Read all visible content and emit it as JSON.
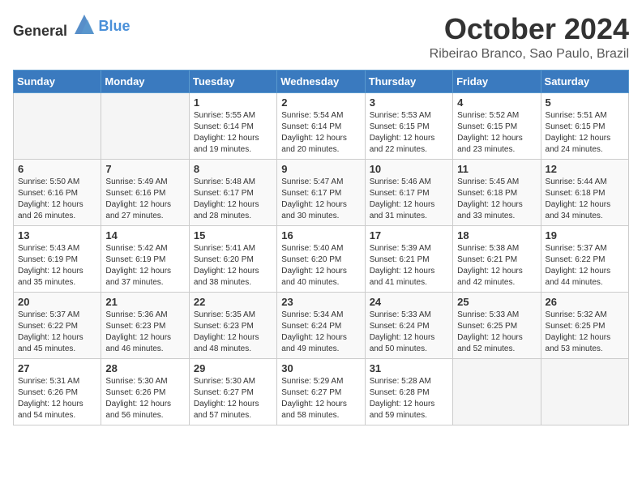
{
  "logo": {
    "general": "General",
    "blue": "Blue"
  },
  "title": "October 2024",
  "location": "Ribeirao Branco, Sao Paulo, Brazil",
  "days": [
    "Sunday",
    "Monday",
    "Tuesday",
    "Wednesday",
    "Thursday",
    "Friday",
    "Saturday"
  ],
  "weeks": [
    [
      {
        "day": "",
        "empty": true
      },
      {
        "day": "",
        "empty": true
      },
      {
        "day": "1",
        "sunrise": "Sunrise: 5:55 AM",
        "sunset": "Sunset: 6:14 PM",
        "daylight": "Daylight: 12 hours and 19 minutes."
      },
      {
        "day": "2",
        "sunrise": "Sunrise: 5:54 AM",
        "sunset": "Sunset: 6:14 PM",
        "daylight": "Daylight: 12 hours and 20 minutes."
      },
      {
        "day": "3",
        "sunrise": "Sunrise: 5:53 AM",
        "sunset": "Sunset: 6:15 PM",
        "daylight": "Daylight: 12 hours and 22 minutes."
      },
      {
        "day": "4",
        "sunrise": "Sunrise: 5:52 AM",
        "sunset": "Sunset: 6:15 PM",
        "daylight": "Daylight: 12 hours and 23 minutes."
      },
      {
        "day": "5",
        "sunrise": "Sunrise: 5:51 AM",
        "sunset": "Sunset: 6:15 PM",
        "daylight": "Daylight: 12 hours and 24 minutes."
      }
    ],
    [
      {
        "day": "6",
        "sunrise": "Sunrise: 5:50 AM",
        "sunset": "Sunset: 6:16 PM",
        "daylight": "Daylight: 12 hours and 26 minutes."
      },
      {
        "day": "7",
        "sunrise": "Sunrise: 5:49 AM",
        "sunset": "Sunset: 6:16 PM",
        "daylight": "Daylight: 12 hours and 27 minutes."
      },
      {
        "day": "8",
        "sunrise": "Sunrise: 5:48 AM",
        "sunset": "Sunset: 6:17 PM",
        "daylight": "Daylight: 12 hours and 28 minutes."
      },
      {
        "day": "9",
        "sunrise": "Sunrise: 5:47 AM",
        "sunset": "Sunset: 6:17 PM",
        "daylight": "Daylight: 12 hours and 30 minutes."
      },
      {
        "day": "10",
        "sunrise": "Sunrise: 5:46 AM",
        "sunset": "Sunset: 6:17 PM",
        "daylight": "Daylight: 12 hours and 31 minutes."
      },
      {
        "day": "11",
        "sunrise": "Sunrise: 5:45 AM",
        "sunset": "Sunset: 6:18 PM",
        "daylight": "Daylight: 12 hours and 33 minutes."
      },
      {
        "day": "12",
        "sunrise": "Sunrise: 5:44 AM",
        "sunset": "Sunset: 6:18 PM",
        "daylight": "Daylight: 12 hours and 34 minutes."
      }
    ],
    [
      {
        "day": "13",
        "sunrise": "Sunrise: 5:43 AM",
        "sunset": "Sunset: 6:19 PM",
        "daylight": "Daylight: 12 hours and 35 minutes."
      },
      {
        "day": "14",
        "sunrise": "Sunrise: 5:42 AM",
        "sunset": "Sunset: 6:19 PM",
        "daylight": "Daylight: 12 hours and 37 minutes."
      },
      {
        "day": "15",
        "sunrise": "Sunrise: 5:41 AM",
        "sunset": "Sunset: 6:20 PM",
        "daylight": "Daylight: 12 hours and 38 minutes."
      },
      {
        "day": "16",
        "sunrise": "Sunrise: 5:40 AM",
        "sunset": "Sunset: 6:20 PM",
        "daylight": "Daylight: 12 hours and 40 minutes."
      },
      {
        "day": "17",
        "sunrise": "Sunrise: 5:39 AM",
        "sunset": "Sunset: 6:21 PM",
        "daylight": "Daylight: 12 hours and 41 minutes."
      },
      {
        "day": "18",
        "sunrise": "Sunrise: 5:38 AM",
        "sunset": "Sunset: 6:21 PM",
        "daylight": "Daylight: 12 hours and 42 minutes."
      },
      {
        "day": "19",
        "sunrise": "Sunrise: 5:37 AM",
        "sunset": "Sunset: 6:22 PM",
        "daylight": "Daylight: 12 hours and 44 minutes."
      }
    ],
    [
      {
        "day": "20",
        "sunrise": "Sunrise: 5:37 AM",
        "sunset": "Sunset: 6:22 PM",
        "daylight": "Daylight: 12 hours and 45 minutes."
      },
      {
        "day": "21",
        "sunrise": "Sunrise: 5:36 AM",
        "sunset": "Sunset: 6:23 PM",
        "daylight": "Daylight: 12 hours and 46 minutes."
      },
      {
        "day": "22",
        "sunrise": "Sunrise: 5:35 AM",
        "sunset": "Sunset: 6:23 PM",
        "daylight": "Daylight: 12 hours and 48 minutes."
      },
      {
        "day": "23",
        "sunrise": "Sunrise: 5:34 AM",
        "sunset": "Sunset: 6:24 PM",
        "daylight": "Daylight: 12 hours and 49 minutes."
      },
      {
        "day": "24",
        "sunrise": "Sunrise: 5:33 AM",
        "sunset": "Sunset: 6:24 PM",
        "daylight": "Daylight: 12 hours and 50 minutes."
      },
      {
        "day": "25",
        "sunrise": "Sunrise: 5:33 AM",
        "sunset": "Sunset: 6:25 PM",
        "daylight": "Daylight: 12 hours and 52 minutes."
      },
      {
        "day": "26",
        "sunrise": "Sunrise: 5:32 AM",
        "sunset": "Sunset: 6:25 PM",
        "daylight": "Daylight: 12 hours and 53 minutes."
      }
    ],
    [
      {
        "day": "27",
        "sunrise": "Sunrise: 5:31 AM",
        "sunset": "Sunset: 6:26 PM",
        "daylight": "Daylight: 12 hours and 54 minutes."
      },
      {
        "day": "28",
        "sunrise": "Sunrise: 5:30 AM",
        "sunset": "Sunset: 6:26 PM",
        "daylight": "Daylight: 12 hours and 56 minutes."
      },
      {
        "day": "29",
        "sunrise": "Sunrise: 5:30 AM",
        "sunset": "Sunset: 6:27 PM",
        "daylight": "Daylight: 12 hours and 57 minutes."
      },
      {
        "day": "30",
        "sunrise": "Sunrise: 5:29 AM",
        "sunset": "Sunset: 6:27 PM",
        "daylight": "Daylight: 12 hours and 58 minutes."
      },
      {
        "day": "31",
        "sunrise": "Sunrise: 5:28 AM",
        "sunset": "Sunset: 6:28 PM",
        "daylight": "Daylight: 12 hours and 59 minutes."
      },
      {
        "day": "",
        "empty": true
      },
      {
        "day": "",
        "empty": true
      }
    ]
  ]
}
